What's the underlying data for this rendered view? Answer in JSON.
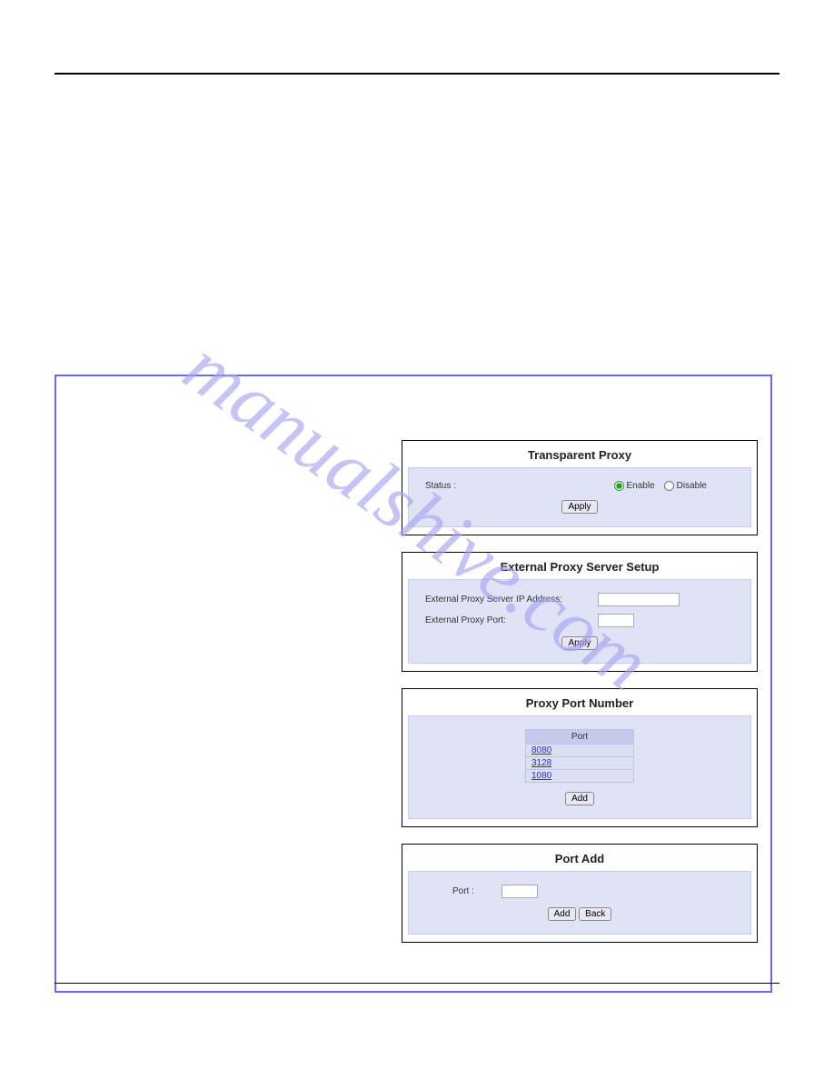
{
  "watermark": "manualshive.com",
  "panels": {
    "transparent_proxy": {
      "title": "Transparent Proxy",
      "status_label": "Status :",
      "enable_label": "Enable",
      "disable_label": "Disable",
      "apply_label": "Apply",
      "selected": "enable"
    },
    "external_proxy": {
      "title": "External Proxy Server Setup",
      "ip_label": "External Proxy Server IP Address:",
      "port_label": "External Proxy Port:",
      "apply_label": "Apply",
      "ip_value": "",
      "port_value": ""
    },
    "proxy_port": {
      "title": "Proxy Port Number",
      "header": "Port",
      "ports": [
        "8080",
        "3128",
        "1080"
      ],
      "add_label": "Add"
    },
    "port_add": {
      "title": "Port Add",
      "port_label": "Port :",
      "port_value": "",
      "add_label": "Add",
      "back_label": "Back"
    }
  }
}
